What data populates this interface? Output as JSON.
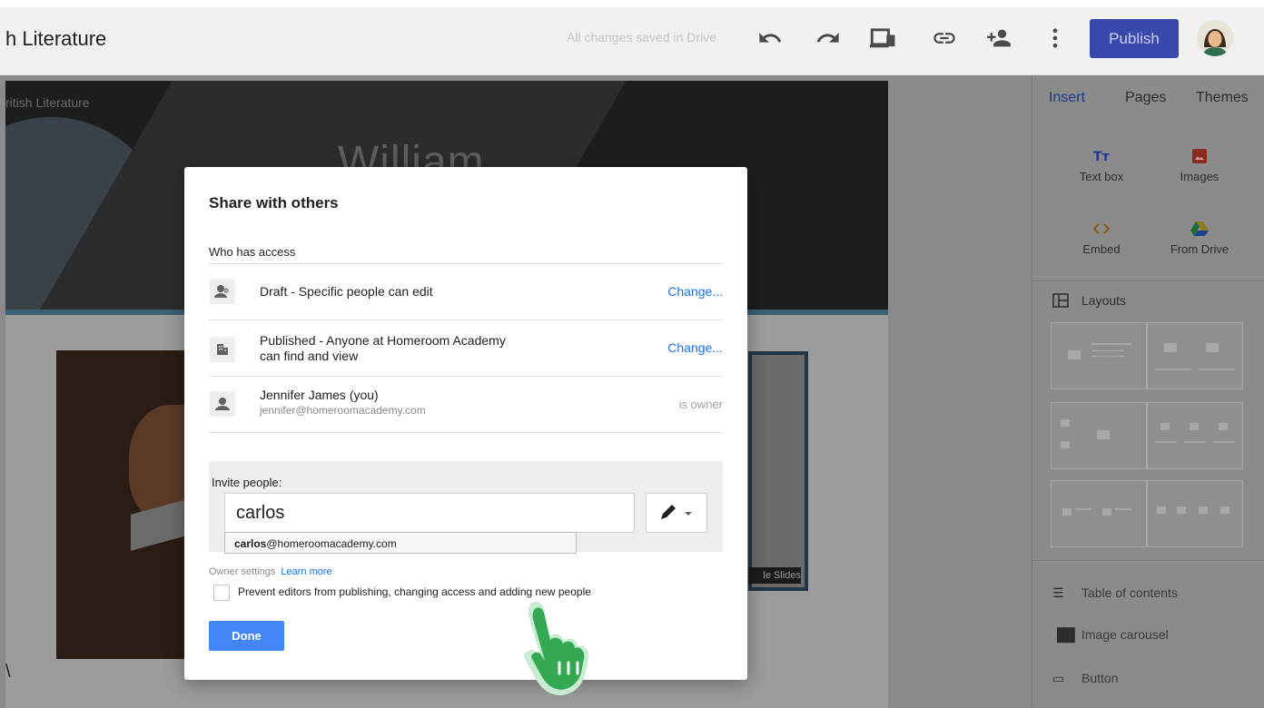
{
  "header": {
    "title": "h Literature",
    "save_status": "All changes saved in Drive",
    "publish_label": "Publish",
    "icons": [
      "undo-icon",
      "redo-icon",
      "preview-icon",
      "link-icon",
      "add-person-icon",
      "more-icon"
    ]
  },
  "page": {
    "site_name": "ritish Literature",
    "hero_title": "William",
    "slide_label": "le Slides",
    "edge_char": "\\"
  },
  "panel": {
    "tabs": [
      "Insert",
      "Pages",
      "Themes"
    ],
    "active_tab": "Insert",
    "insert_items": [
      "Text box",
      "Images",
      "Embed",
      "From Drive"
    ],
    "layouts_label": "Layouts",
    "items": [
      "Table of contents",
      "Image carousel",
      "Button"
    ]
  },
  "dialog": {
    "title": "Share with others",
    "who_has_access": "Who has access",
    "rows": [
      {
        "text": "Draft - Specific people can edit",
        "action": "Change..."
      },
      {
        "text": "Published - Anyone at Homeroom Academy",
        "text2": "can find and view",
        "action": "Change..."
      },
      {
        "text": "Jennifer James (you)",
        "sub": "jennifer@homeroomacademy.com",
        "status": "is owner"
      }
    ],
    "invite_label": "Invite people:",
    "invite_value": "carlos",
    "suggestion_bold": "carlos",
    "suggestion_rest": "@homeroomacademy.com",
    "owner_settings": "Owner settings",
    "learn_more": "Learn more",
    "prevent_label": "Prevent editors from publishing, changing access and adding new people",
    "done_label": "Done"
  },
  "colors": {
    "accent": "#3949ab",
    "link": "#1a73e8",
    "done": "#4285f4",
    "pointer": "#34a853"
  }
}
